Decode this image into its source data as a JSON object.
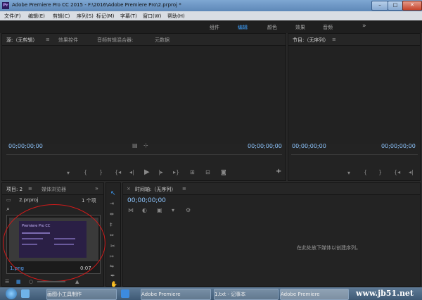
{
  "window": {
    "title": "Adobe Premiere Pro CC 2015 - F:\\2016\\Adobe Premiere Pro\\2.prproj *",
    "app_badge": "Pr",
    "minimize": "–",
    "maximize": "□",
    "close": "✕"
  },
  "menu": [
    "文件(F)",
    "编辑(E)",
    "剪辑(C)",
    "序列(S)",
    "标记(M)",
    "字幕(T)",
    "窗口(W)",
    "帮助(H)"
  ],
  "workspaces": {
    "items": [
      "组件",
      "编辑",
      "颜色",
      "效果",
      "音频"
    ],
    "active": "编辑",
    "more": "»"
  },
  "source_panel": {
    "tabs": [
      "源:（无剪辑）",
      "效果控件",
      "音频剪辑混合器:",
      "元数据"
    ],
    "menu_glyph": "≡",
    "timecode_left": "00;00;00;00",
    "timecode_right": "00;00;00;00",
    "add_glyph": "+"
  },
  "program_panel": {
    "tab": "节目:（无序列）",
    "menu_glyph": "≡",
    "timecode_left": "00;00;00;00",
    "timecode_right": "00;00;00;00"
  },
  "project_panel": {
    "tabs": [
      "项目: 2",
      "媒体浏览器"
    ],
    "more": "»",
    "file_name": "2.prproj",
    "item_count": "1 个项",
    "search_glyph": "⌕",
    "clip": {
      "name": "1.png",
      "duration": "0:07",
      "thumb_title": "Premiere Pro CC"
    }
  },
  "timeline_panel": {
    "close": "×",
    "tab": "时间轴:（无序列）",
    "menu_glyph": "≡",
    "timecode": "00;00;00;00",
    "empty_message": "在此处放下媒体以创建序列。"
  },
  "taskbar": {
    "items": [
      "画图小工具制作",
      "Adobe Premiere",
      "1.txt - 记事本",
      "Adobe Premiere"
    ],
    "watermark": "www.jb51.net"
  },
  "colors": {
    "accent": "#3ea1ff",
    "timecode": "#8ec6ff",
    "annotation_circle": "#d11a1a"
  }
}
